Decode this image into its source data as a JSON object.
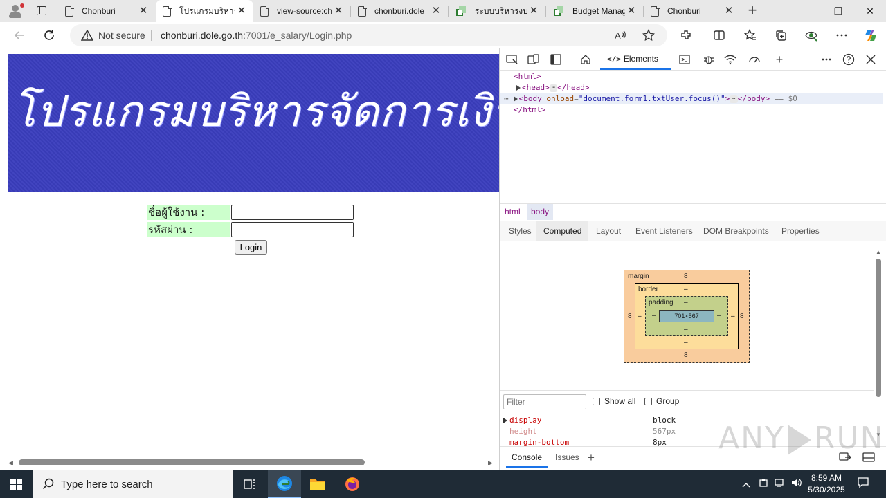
{
  "browser": {
    "tabs": [
      {
        "label": "Chonburi",
        "icon": "document-icon",
        "active": false
      },
      {
        "label": "โปรแกรมบริหารจัดการ",
        "icon": "document-icon",
        "active": true
      },
      {
        "label": "view-source:ch",
        "icon": "document-icon",
        "active": false
      },
      {
        "label": "chonburi.dole",
        "icon": "document-icon",
        "active": false
      },
      {
        "label": "ระบบบริหารงบป",
        "icon": "spreadsheet-icon",
        "active": false
      },
      {
        "label": "Budget Manag",
        "icon": "spreadsheet-icon",
        "active": false
      },
      {
        "label": "Chonburi",
        "icon": "document-icon",
        "active": false
      }
    ],
    "close_glyph": "✕",
    "new_tab_glyph": "+",
    "window_controls": {
      "minimize": "—",
      "restore": "❐",
      "close": "✕"
    },
    "address": {
      "security_label": "Not secure",
      "url_host": "chonburi.dole.go.th",
      "url_rest": ":7001/e_salary/Login.php"
    }
  },
  "page": {
    "banner_text": "โปรแกรมบริหารจัดการเงินเดือน E-Salary สำนักงาน",
    "form": {
      "username_label": "ชื่อผู้ใช้งาน :",
      "password_label": "รหัสผ่าน :",
      "username_value": "",
      "password_value": "",
      "login_button": "Login"
    }
  },
  "devtools": {
    "main_tab": "Elements",
    "dom": {
      "html_open": "<html>",
      "head_open": "<head>",
      "head_close": "</head>",
      "body_tag": "<body",
      "body_attr": "onload",
      "body_attr_value": "\"document.form1.txtUser.focus()\"",
      "body_tag_end": ">",
      "body_close": "</body>",
      "ellipsis": "⋯",
      "sel_marker": "== $0",
      "html_close": "</html>",
      "row_marker": "⋯"
    },
    "breadcrumbs": [
      "html",
      "body"
    ],
    "subtabs": [
      "Styles",
      "Computed",
      "Layout",
      "Event Listeners",
      "DOM Breakpoints",
      "Properties"
    ],
    "active_subtab": "Computed",
    "box_model": {
      "margin_label": "margin",
      "border_label": "border",
      "padding_label": "padding",
      "margin_top": "8",
      "margin_bottom": "8",
      "margin_left": "8",
      "margin_right": "8",
      "border_top": "–",
      "border_bottom": "–",
      "border_left": "–",
      "border_right": "–",
      "padding_top": "–",
      "padding_bottom": "–",
      "padding_left": "–",
      "padding_right": "–",
      "content": "701×567"
    },
    "filter_placeholder": "Filter",
    "show_all_label": "Show all",
    "group_label": "Group",
    "properties": [
      {
        "name": "display",
        "value": "block"
      },
      {
        "name": "height",
        "value": "567px"
      },
      {
        "name": "margin-bottom",
        "value": "8px"
      }
    ],
    "drawer_tabs": [
      "Console",
      "Issues"
    ]
  },
  "watermark": {
    "left": "ANY",
    "right": "RUN"
  },
  "taskbar": {
    "search_placeholder": "Type here to search",
    "time": "8:59 AM",
    "date": "5/30/2025"
  }
}
